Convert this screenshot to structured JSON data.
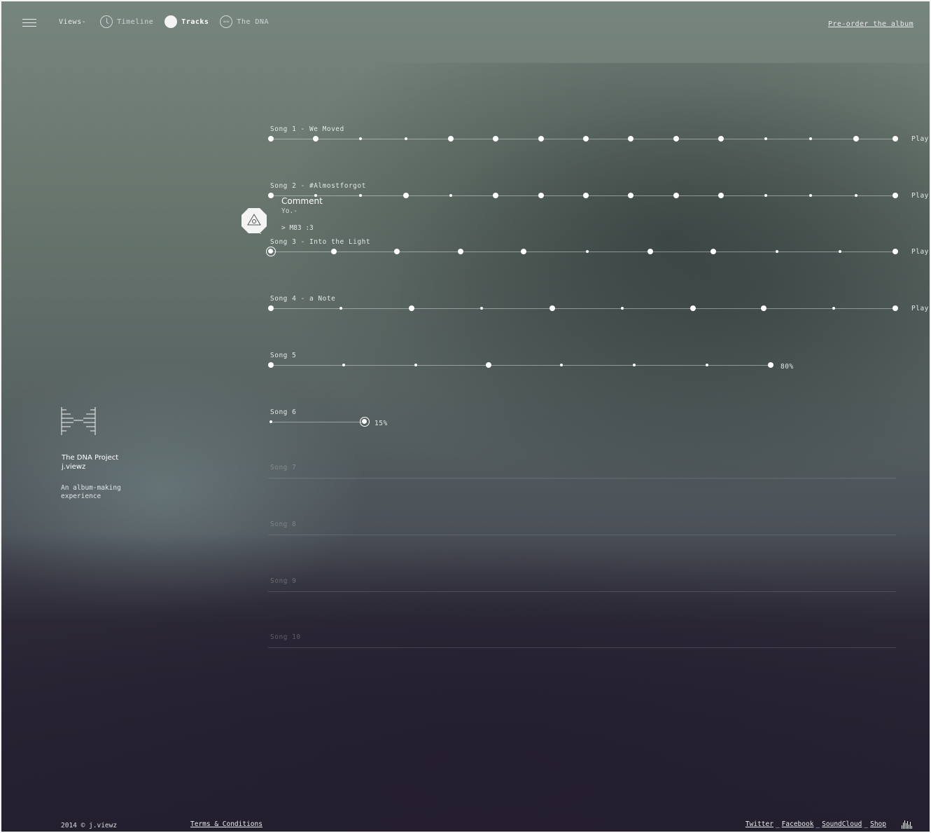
{
  "nav": {
    "menu_icon": "hamburger-icon",
    "views_label": "Views-",
    "items": [
      {
        "label": "Timeline",
        "icon": "clock-icon",
        "active": false
      },
      {
        "label": "Tracks",
        "icon": "disc-icon",
        "active": true
      },
      {
        "label": "The DNA",
        "icon": "dna-icon",
        "active": false
      }
    ],
    "preorder_label": "Pre-order the album"
  },
  "tracks": [
    {
      "title": "Song 1 - We Moved",
      "play": "Play"
    },
    {
      "title": "Song 2 - #Almostforgot",
      "play": "Play"
    },
    {
      "title": "Song 3 - Into the Light",
      "play": "Play"
    },
    {
      "title": "Song 4 - a Note",
      "play": "Play"
    },
    {
      "title": "Song 5",
      "progress_label": "80%",
      "progress": 0.8
    },
    {
      "title": "Song 6",
      "progress_label": "15%",
      "progress": 0.15
    },
    {
      "title": "Song 7"
    },
    {
      "title": "Song 8"
    },
    {
      "title": "Song 9"
    },
    {
      "title": "Song 10"
    }
  ],
  "comment": {
    "title": "Comment",
    "subtitle": "Yo.-",
    "body": "> M83 :3",
    "badge_icon": "eye-triangle-icon"
  },
  "project": {
    "name": "The DNA Project",
    "author": "j.viewz",
    "tagline_1": "An album-making",
    "tagline_2": "experience"
  },
  "footer": {
    "copyright": "2014 © j.viewz",
    "terms": "Terms & Conditions",
    "links": [
      "Twitter",
      "Facebook",
      "SoundCloud",
      "Shop"
    ],
    "bars_icon": "audio-bars-icon"
  },
  "colors": {
    "accent": "#ffffff",
    "text": "#e2e7e7"
  }
}
